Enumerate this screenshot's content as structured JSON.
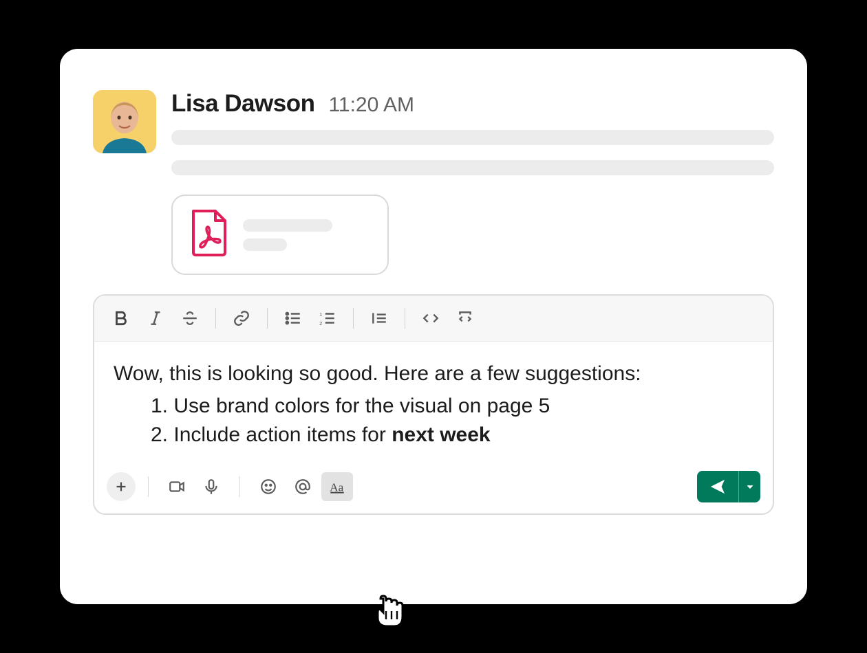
{
  "message": {
    "sender_name": "Lisa Dawson",
    "timestamp": "11:20 AM"
  },
  "composer": {
    "intro_text": "Wow, this is looking so good. Here are a few suggestions:",
    "list_item_1": "Use brand colors for the visual on page 5",
    "list_item_2_prefix": "Include action items for ",
    "list_item_2_bold": "next week"
  }
}
